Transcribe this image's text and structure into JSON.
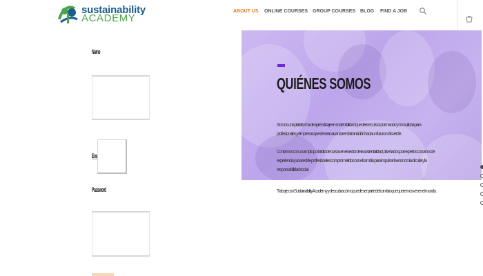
{
  "header": {
    "logo": {
      "line1": "sustainability",
      "line2": "ACADEMY",
      "mark": "SA"
    },
    "nav": [
      {
        "label": "ABOUT US",
        "active": true
      },
      {
        "label": "ONLINE COURSES",
        "active": false
      },
      {
        "label": "GROUP COURSES",
        "active": false
      },
      {
        "label": "BLOG",
        "active": false
      },
      {
        "label": "FIND A JOB",
        "active": false
      }
    ],
    "search_icon": "search-icon",
    "cart_icon": "cart-icon",
    "accent_color": "#e07b22"
  },
  "form": {
    "name_label": "Name",
    "email_label": "Email",
    "password_label": "Password"
  },
  "hero": {
    "title": "QUIÉNES SOMOS",
    "paragraphs": [
      "Somos una plataforma de aprendizaje en sostenibilidad que ofrece cursos, formación y consultoría para profesionales y empresas que desean avanzar en la transición hacia un futuro más verde.",
      "Contamos con un amplio portafolio de cursos en el sector de la sostenibilidad, diseñados por expertos con años de experiencia y una red de profesionales comprometidos con el cambio para impulsar la economía circular y la responsabilidad social.",
      "Trabaje con Sustainability Academy y descubra cómo puede ser parte del cambio que queremos ver en el mundo."
    ],
    "accent_color": "#6a2ad6"
  }
}
